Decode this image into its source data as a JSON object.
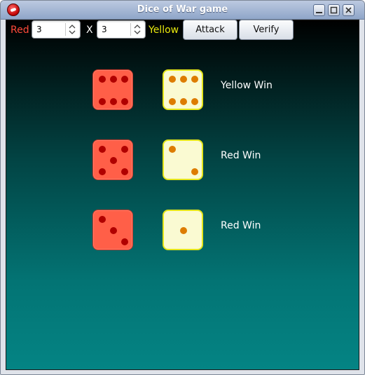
{
  "window": {
    "title": "Dice of War game"
  },
  "toolbar": {
    "red_label": "Red",
    "red_count": "3",
    "x_label": "X",
    "yellow_count": "3",
    "yellow_label": "Yellow",
    "attack_label": "Attack",
    "verify_label": "Verify"
  },
  "colors": {
    "red_label": "#ff4a3a",
    "yellow_label": "#e8e80e",
    "red_die": "#ff5f48",
    "yellow_die": "#fafad2"
  },
  "rounds": [
    {
      "red": 6,
      "yellow": 6,
      "result": "Yellow Win"
    },
    {
      "red": 5,
      "yellow": 2,
      "result": "Red Win"
    },
    {
      "red": 3,
      "yellow": 1,
      "result": "Red Win"
    }
  ]
}
